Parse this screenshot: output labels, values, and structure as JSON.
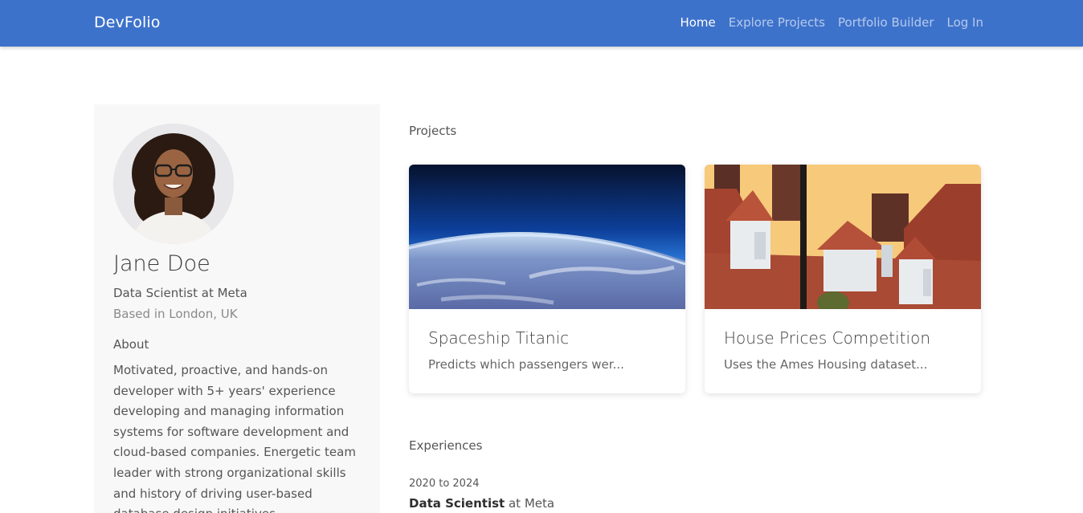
{
  "navbar": {
    "brand": "DevFolio",
    "links": [
      {
        "label": "Home",
        "active": true
      },
      {
        "label": "Explore Projects",
        "active": false
      },
      {
        "label": "Portfolio Builder",
        "active": false
      },
      {
        "label": "Log In",
        "active": false
      }
    ],
    "color": "#3d72cb"
  },
  "profile": {
    "name": "Jane Doe",
    "title": "Data Scientist at Meta",
    "location": "Based in London, UK",
    "about_heading": "About",
    "about_text": "Motivated, proactive, and hands-on developer with 5+ years' experience developing and managing information systems for software development and cloud-based companies. Energetic team leader with strong organizational skills and history of driving user-based database design initiatives."
  },
  "projects": {
    "heading": "Projects",
    "items": [
      {
        "title": "Spaceship Titanic",
        "description": "Predicts which passengers wer..."
      },
      {
        "title": "House Prices Competition",
        "description": "Uses the Ames Housing dataset..."
      }
    ]
  },
  "experiences": {
    "heading": "Experiences",
    "items": [
      {
        "years": "2020 to 2024",
        "role": "Data Scientist",
        "connector": "at",
        "company": "Meta"
      }
    ]
  }
}
